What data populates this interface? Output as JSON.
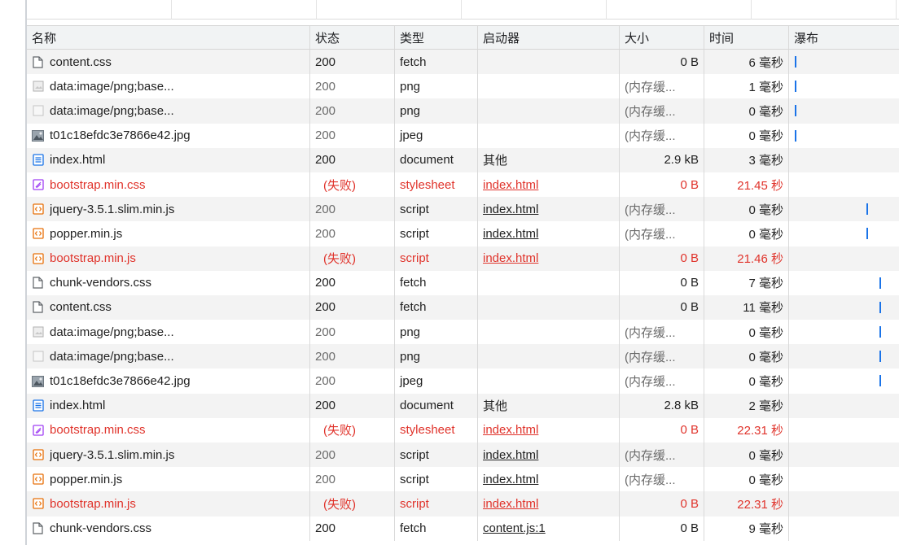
{
  "columns": {
    "name": "名称",
    "status": "状态",
    "type": "类型",
    "initiator": "启动器",
    "size": "大小",
    "time": "时间",
    "waterfall": "瀑布"
  },
  "rows": [
    {
      "icon": "file-icon",
      "name": "content.css",
      "status": "200",
      "type": "fetch",
      "initiator": "",
      "size": "0 B",
      "time": "6 毫秒",
      "state": "normal",
      "wf": 0.05
    },
    {
      "icon": "image-icon",
      "name": "data:image/png;base...",
      "status": "200",
      "type": "png",
      "initiator": "",
      "size": "(内存缓...",
      "time": "1 毫秒",
      "state": "cached",
      "wf": 0.05
    },
    {
      "icon": "blank-image-icon",
      "name": "data:image/png;base...",
      "status": "200",
      "type": "png",
      "initiator": "",
      "size": "(内存缓...",
      "time": "0 毫秒",
      "state": "cached",
      "wf": 0.05
    },
    {
      "icon": "jpeg-thumbnail-icon",
      "name": "t01c18efdc3e7866e42.jpg",
      "status": "200",
      "type": "jpeg",
      "initiator": "",
      "size": "(内存缓...",
      "time": "0 毫秒",
      "state": "cached",
      "wf": 0.05
    },
    {
      "icon": "document-icon",
      "name": "index.html",
      "status": "200",
      "type": "document",
      "initiator": "其他",
      "size": "2.9 kB",
      "time": "3 毫秒",
      "state": "normal",
      "wf": null
    },
    {
      "icon": "stylesheet-icon",
      "name": "bootstrap.min.css",
      "status": "(失败)",
      "type": "stylesheet",
      "initiator": "index.html",
      "size": "0 B",
      "time": "21.45 秒",
      "state": "failed",
      "wf": null
    },
    {
      "icon": "script-icon",
      "name": "jquery-3.5.1.slim.min.js",
      "status": "200",
      "type": "script",
      "initiator": "index.html",
      "size": "(内存缓...",
      "time": "0 毫秒",
      "state": "cached",
      "wf": 0.7
    },
    {
      "icon": "script-icon",
      "name": "popper.min.js",
      "status": "200",
      "type": "script",
      "initiator": "index.html",
      "size": "(内存缓...",
      "time": "0 毫秒",
      "state": "cached",
      "wf": 0.7
    },
    {
      "icon": "script-icon",
      "name": "bootstrap.min.js",
      "status": "(失败)",
      "type": "script",
      "initiator": "index.html",
      "size": "0 B",
      "time": "21.46 秒",
      "state": "failed",
      "wf": null
    },
    {
      "icon": "file-icon",
      "name": "chunk-vendors.css",
      "status": "200",
      "type": "fetch",
      "initiator": "",
      "size": "0 B",
      "time": "7 毫秒",
      "state": "normal",
      "wf": 0.82
    },
    {
      "icon": "file-icon",
      "name": "content.css",
      "status": "200",
      "type": "fetch",
      "initiator": "",
      "size": "0 B",
      "time": "11 毫秒",
      "state": "normal",
      "wf": 0.82
    },
    {
      "icon": "image-icon",
      "name": "data:image/png;base...",
      "status": "200",
      "type": "png",
      "initiator": "",
      "size": "(内存缓...",
      "time": "0 毫秒",
      "state": "cached",
      "wf": 0.82
    },
    {
      "icon": "blank-image-icon",
      "name": "data:image/png;base...",
      "status": "200",
      "type": "png",
      "initiator": "",
      "size": "(内存缓...",
      "time": "0 毫秒",
      "state": "cached",
      "wf": 0.82
    },
    {
      "icon": "jpeg-thumbnail-icon",
      "name": "t01c18efdc3e7866e42.jpg",
      "status": "200",
      "type": "jpeg",
      "initiator": "",
      "size": "(内存缓...",
      "time": "0 毫秒",
      "state": "cached",
      "wf": 0.82
    },
    {
      "icon": "document-icon",
      "name": "index.html",
      "status": "200",
      "type": "document",
      "initiator": "其他",
      "size": "2.8 kB",
      "time": "2 毫秒",
      "state": "normal",
      "wf": null
    },
    {
      "icon": "stylesheet-icon",
      "name": "bootstrap.min.css",
      "status": "(失败)",
      "type": "stylesheet",
      "initiator": "index.html",
      "size": "0 B",
      "time": "22.31 秒",
      "state": "failed",
      "wf": null
    },
    {
      "icon": "script-icon",
      "name": "jquery-3.5.1.slim.min.js",
      "status": "200",
      "type": "script",
      "initiator": "index.html",
      "size": "(内存缓...",
      "time": "0 毫秒",
      "state": "cached",
      "wf": null
    },
    {
      "icon": "script-icon",
      "name": "popper.min.js",
      "status": "200",
      "type": "script",
      "initiator": "index.html",
      "size": "(内存缓...",
      "time": "0 毫秒",
      "state": "cached",
      "wf": null
    },
    {
      "icon": "script-icon",
      "name": "bootstrap.min.js",
      "status": "(失败)",
      "type": "script",
      "initiator": "index.html",
      "size": "0 B",
      "time": "22.31 秒",
      "state": "failed",
      "wf": null
    },
    {
      "icon": "file-icon",
      "name": "chunk-vendors.css",
      "status": "200",
      "type": "fetch",
      "initiator": "content.js:1",
      "size": "0 B",
      "time": "9 毫秒",
      "state": "normal",
      "wf": null
    }
  ],
  "colors": {
    "failed": "#e0332b",
    "waterfall": "#1a73e8",
    "script_icon": "#e8710a",
    "stylesheet_icon": "#a142f4",
    "document_icon": "#1a73e8"
  }
}
